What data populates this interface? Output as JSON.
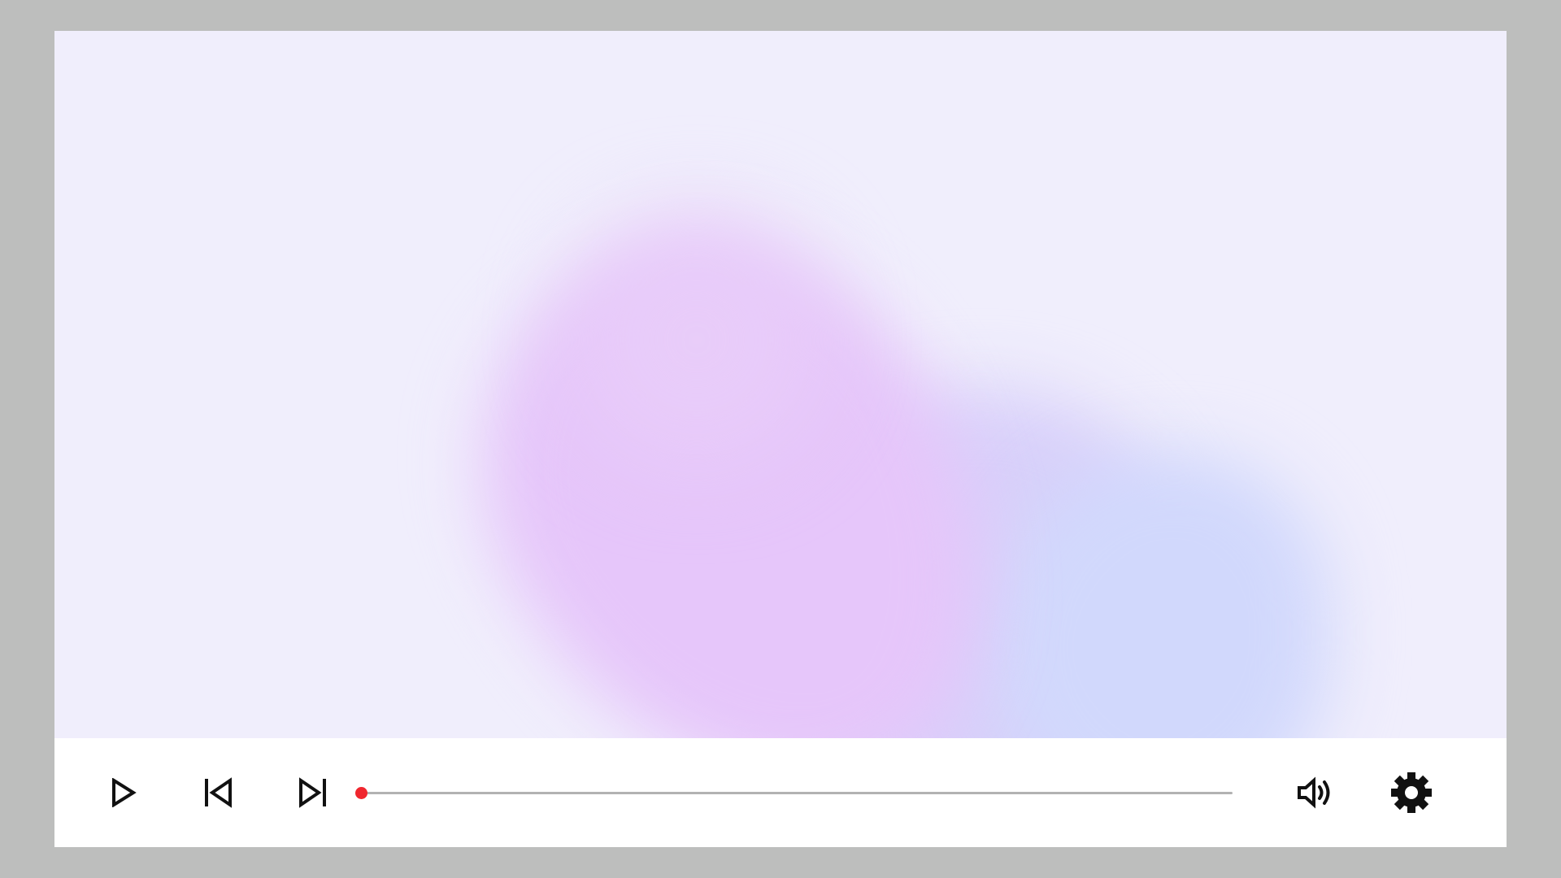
{
  "player": {
    "video": {
      "background_color": "#f0eefc",
      "gradient_colors": [
        "#e6c6fa",
        "#d8d0fa",
        "#d1d8fc"
      ]
    },
    "controls": {
      "play_icon": "play-icon",
      "previous_icon": "skip-previous-icon",
      "next_icon": "skip-next-icon",
      "volume_icon": "volume-up-icon",
      "settings_icon": "gear-icon"
    },
    "seek": {
      "progress": 0.0,
      "accent_color": "#f0262e",
      "track_color": "#b2b2b2"
    }
  }
}
